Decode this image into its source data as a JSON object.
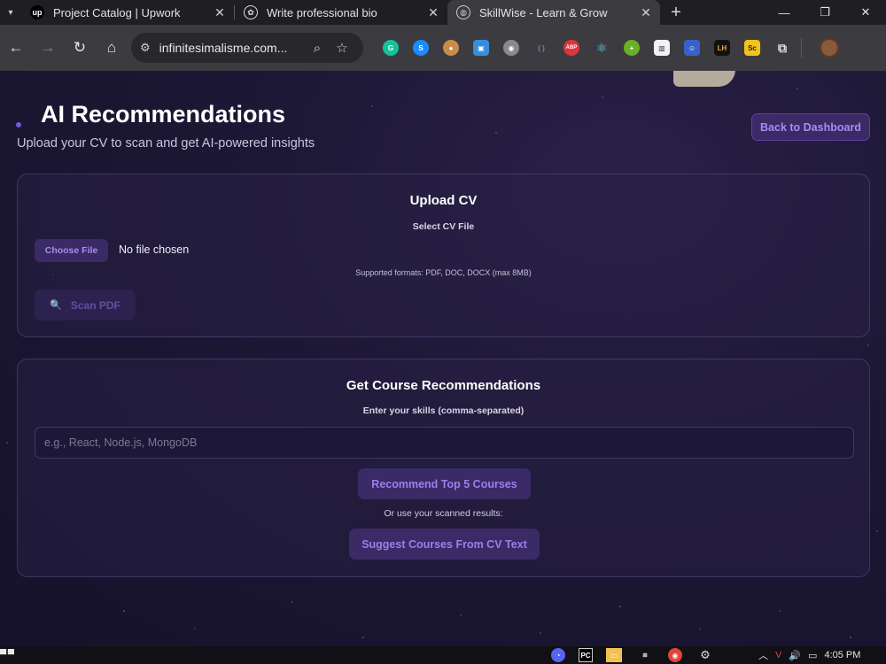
{
  "browser": {
    "tabs": [
      {
        "title": "Project Catalog | Upwork",
        "favicon": "upwork-icon",
        "active": false
      },
      {
        "title": "Write professional bio",
        "favicon": "openai-icon",
        "active": false
      },
      {
        "title": "SkillWise - Learn & Grow",
        "favicon": "globe-icon",
        "active": true
      }
    ],
    "url": "infinitesimalisme.com...",
    "extensions": [
      "grammarly-icon",
      "shazam-icon",
      "cookie-icon",
      "screen-icon",
      "raccoon-icon",
      "bracket-icon",
      "abp-icon",
      "react-icon",
      "plus-icon",
      "chart-icon",
      "user-icon",
      "lh-icon",
      "sc-icon",
      "puzzle-icon"
    ]
  },
  "page": {
    "title": "AI Recommendations",
    "subtitle": "Upload your CV to scan and get AI-powered insights",
    "back_button": "Back to Dashboard",
    "upload": {
      "title": "Upload CV",
      "file_label": "Select CV File",
      "choose_button": "Choose File",
      "file_status": "No file chosen",
      "formats": "Supported formats: PDF, DOC, DOCX (max 8MB)",
      "scan_button": "Scan PDF",
      "scan_icon": "magnifier-icon"
    },
    "courses": {
      "title": "Get Course Recommendations",
      "skills_label": "Enter your skills (comma-separated)",
      "skills_placeholder": "e.g., React, Node.js, MongoDB",
      "recommend_button": "Recommend Top 5 Courses",
      "or_text": "Or use your scanned results:",
      "suggest_button": "Suggest Courses From CV Text"
    }
  },
  "taskbar": {
    "time": "4:05 PM"
  },
  "colors": {
    "accent": "#a68cf2",
    "button_bg": "#3a2a66",
    "page_bg": "#1c1734"
  }
}
